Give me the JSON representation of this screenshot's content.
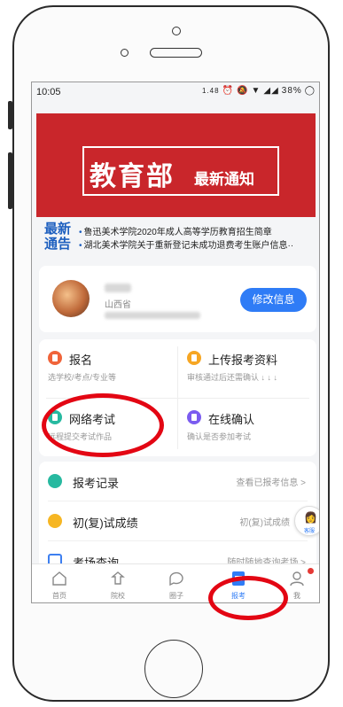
{
  "status": {
    "time": "10:05",
    "speed": "1.48",
    "battery": "38%"
  },
  "banner": {
    "title_big": "教育部",
    "title_small": "最新通知"
  },
  "notice": {
    "label": "最新\n通告",
    "items": [
      "鲁迅美术学院2020年成人高等学历教育招生简章",
      "湖北美术学院关于重新登记未成功退费考生账户信息··"
    ]
  },
  "profile": {
    "region": "山西省",
    "edit_label": "修改信息"
  },
  "grid": [
    {
      "title": "报名",
      "sub": "选学校/考点/专业等",
      "color": "#f0643a"
    },
    {
      "title": "上传报考资料",
      "sub": "审核通过后还需确认 ↓ ↓ ↓",
      "color": "#f6a623"
    },
    {
      "title": "网络考试",
      "sub": "远程提交考试作品",
      "color": "#27b9a0"
    },
    {
      "title": "在线确认",
      "sub": "确认是否参加考试",
      "color": "#7b5cf0"
    }
  ],
  "list": [
    {
      "label": "报考记录",
      "right": "查看已报考信息 >",
      "color": "#27b9a0"
    },
    {
      "label": "初(复)试成绩",
      "right": "初(复)试成绩",
      "color": "#f6b623"
    },
    {
      "label": "考场查询",
      "right": "随时随地查询考场 >",
      "color": "#3d7ff0"
    }
  ],
  "float_agent": {
    "label": "客服"
  },
  "tabs": [
    {
      "label": "首页",
      "icon": "home-icon"
    },
    {
      "label": "院校",
      "icon": "school-icon"
    },
    {
      "label": "圈子",
      "icon": "chat-icon"
    },
    {
      "label": "报考",
      "icon": "apply-icon",
      "active": true
    },
    {
      "label": "我",
      "icon": "user-icon"
    }
  ],
  "accent": "#2f7cf6",
  "annotation_color": "#e30613"
}
